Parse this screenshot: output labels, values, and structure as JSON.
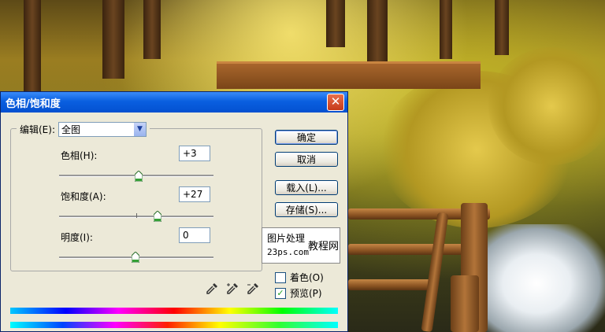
{
  "dialog": {
    "title": "色相/饱和度",
    "edit_label": "编辑(E):",
    "edit_value": "全图",
    "hue": {
      "label": "色相(H):",
      "value": "+3",
      "level": 0.5
    },
    "saturation": {
      "label": "饱和度(A):",
      "value": "+27",
      "level": 0.63
    },
    "lightness": {
      "label": "明度(I):",
      "value": "0",
      "level": 0.5
    },
    "buttons": {
      "ok": "确定",
      "cancel": "取消",
      "load": "载入(L)...",
      "save": "存储(S)..."
    },
    "colorize": {
      "label": "着色(O)",
      "checked": false
    },
    "preview": {
      "label": "预览(P)",
      "checked": true
    },
    "watermark": {
      "line1": "图片处理",
      "line2": "教程网",
      "site": "23ps.com"
    }
  },
  "colors": {
    "titlebar": "#0a5fe0",
    "dialog_bg": "#ece9d8",
    "close": "#c63a19"
  }
}
